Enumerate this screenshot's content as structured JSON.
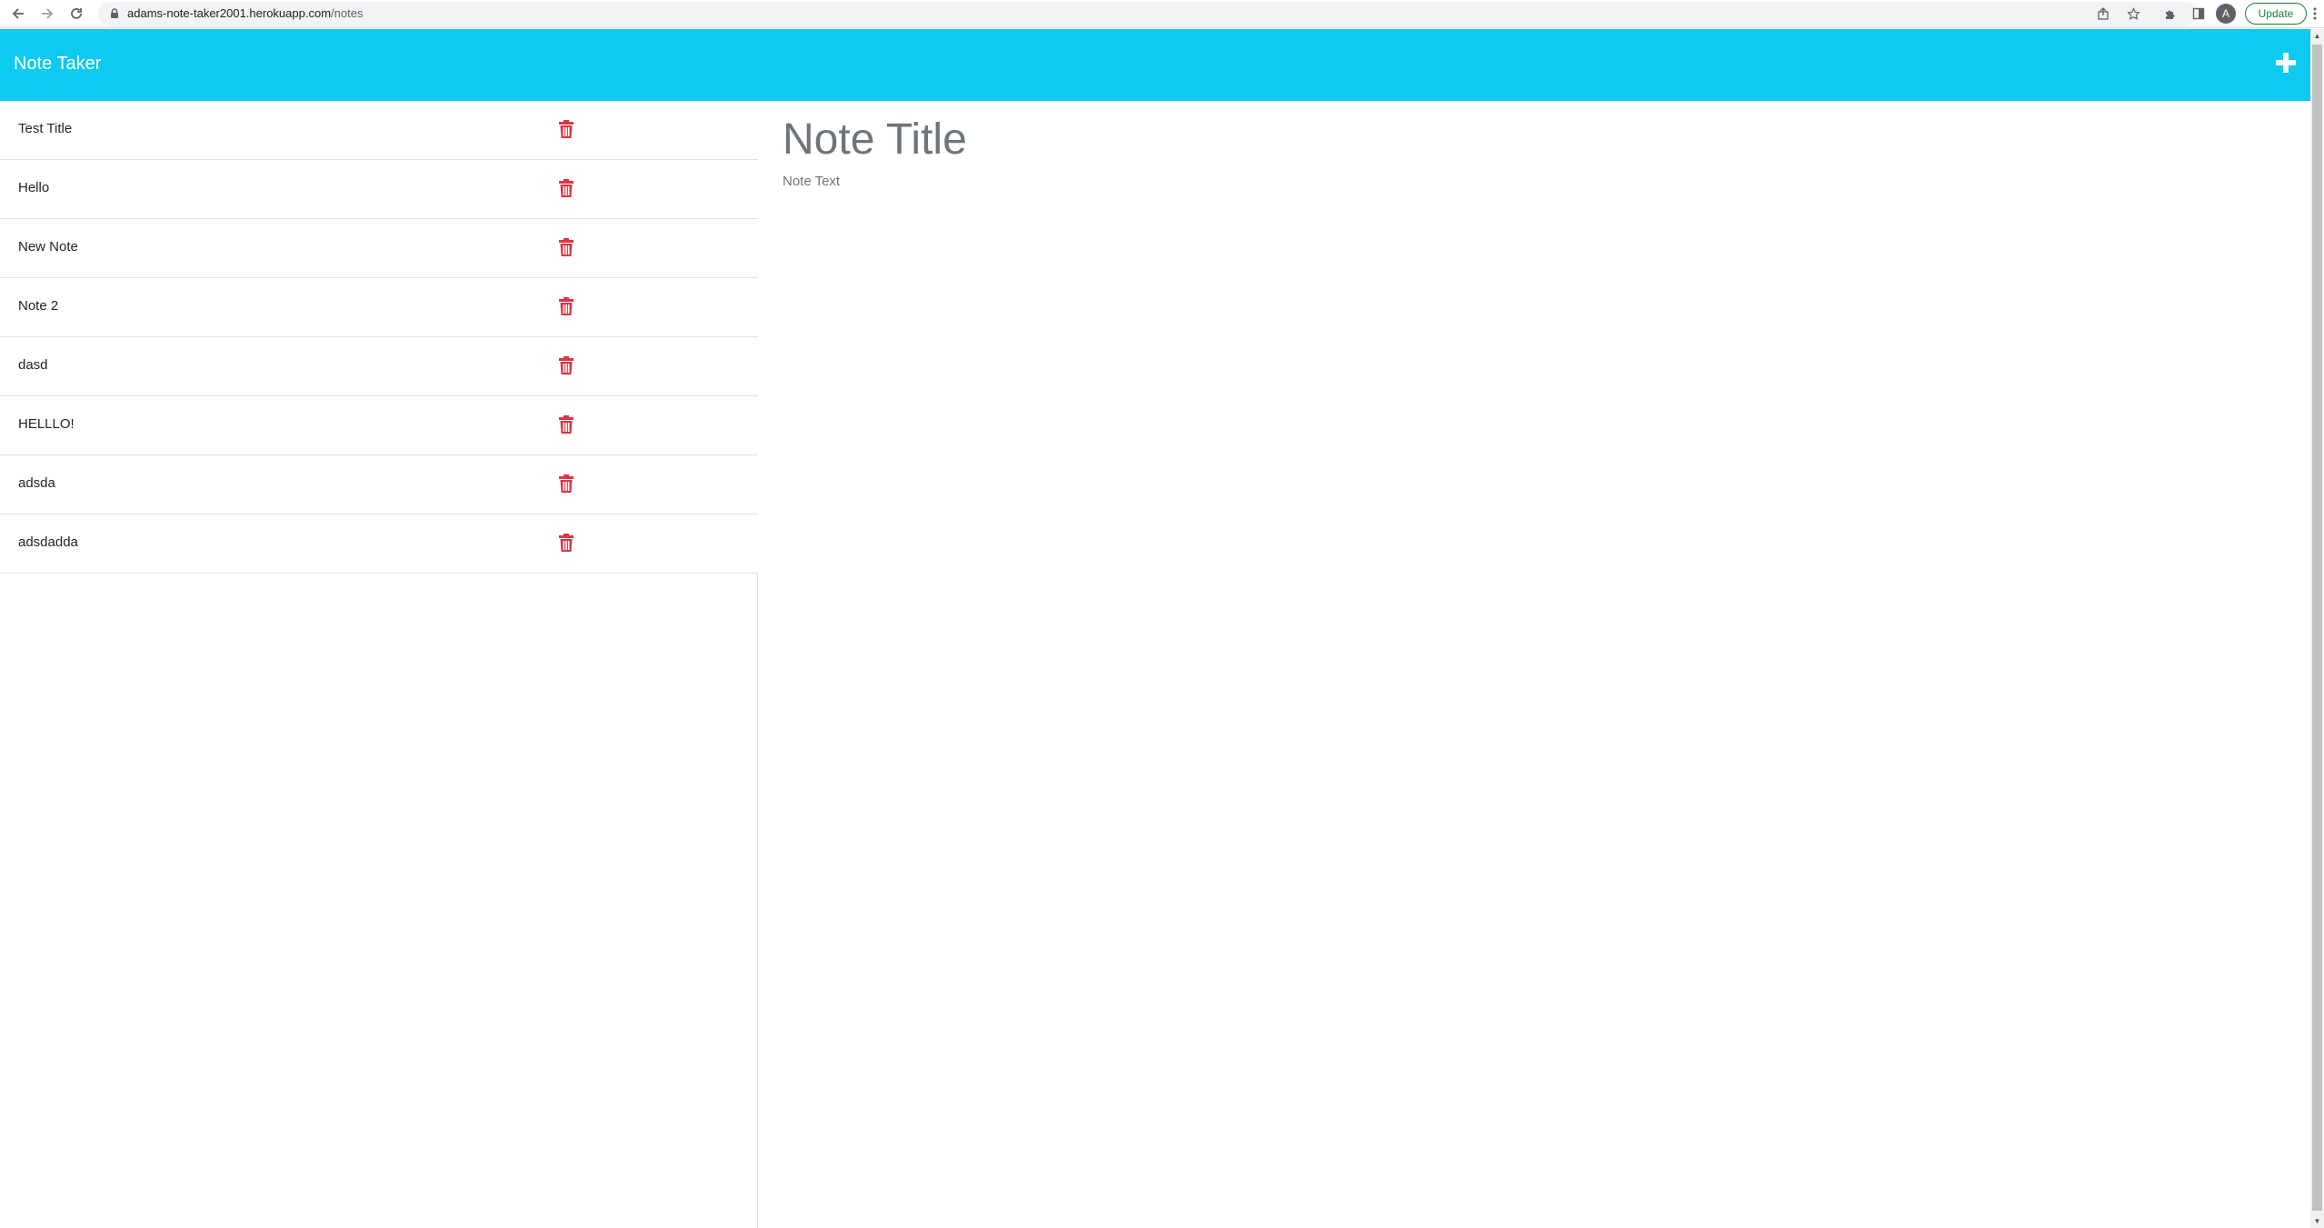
{
  "browser": {
    "url_host": "adams-note-taker2001.herokuapp.com",
    "url_path": "/notes",
    "avatar_letter": "A",
    "update_label": "Update",
    "icons": [
      "back-icon",
      "forward-icon",
      "reload-icon",
      "lock-icon",
      "share-icon",
      "star-icon",
      "extensions-icon",
      "side-panel-icon",
      "kebab-menu-icon"
    ]
  },
  "header": {
    "title": "Note Taker",
    "add_icon": "plus-icon",
    "color": "#0dcaf0"
  },
  "notes": [
    {
      "title": "Test Title"
    },
    {
      "title": "Hello"
    },
    {
      "title": "New Note"
    },
    {
      "title": "Note 2"
    },
    {
      "title": "dasd"
    },
    {
      "title": "HELLLO!"
    },
    {
      "title": "adsda"
    },
    {
      "title": "adsdadda"
    }
  ],
  "delete_icon": "trash-icon",
  "delete_color": "#dc3545",
  "editor": {
    "title_placeholder": "Note Title",
    "text_placeholder": "Note Text"
  }
}
